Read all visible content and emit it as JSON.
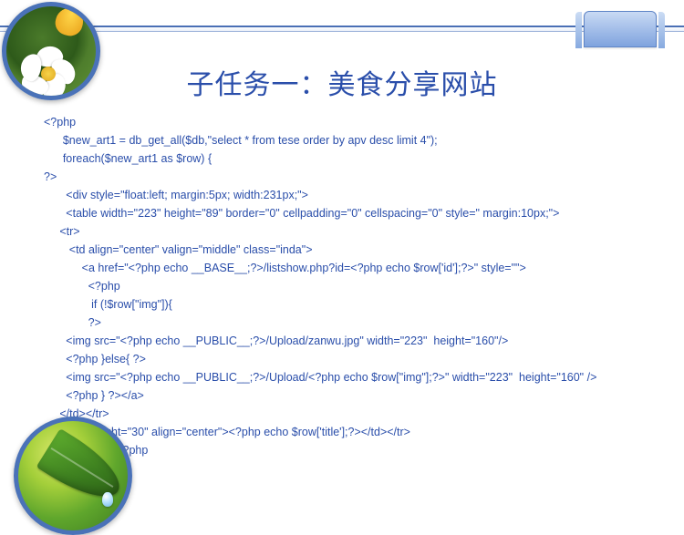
{
  "title": "子任务一：美食分享网站",
  "code_lines": [
    "<?php",
    "      $new_art1 = db_get_all($db,\"select * from tese order by apv desc limit 4\");",
    "      foreach($new_art1 as $row) {",
    "?>",
    "       <div style=\"float:left; margin:5px; width:231px;\">",
    "       <table width=\"223\" height=\"89\" border=\"0\" cellpadding=\"0\" cellspacing=\"0\" style=\" margin:10px;\">",
    "     <tr>",
    "        <td align=\"center\" valign=\"middle\" class=\"inda\">",
    "            <a href=\"<?php echo __BASE__;?>/listshow.php?id=<?php echo $row['id'];?>\" style=\"\">",
    "              <?php",
    "               if (!$row[\"img\"]){",
    "              ?>",
    "       <img src=\"<?php echo __PUBLIC__;?>/Upload/zanwu.jpg\" width=\"223\"  height=\"160\"/>",
    "       <?php }else{ ?>",
    "       <img src=\"<?php echo __PUBLIC__;?>/Upload/<?php echo $row[\"img\"];?>\" width=\"223\"  height=\"160\" />",
    "       <?php } ?></a>",
    "     </td></tr>",
    "  <tr><td height=\"30\" align=\"center\"><?php echo $row['title'];?></td></tr>",
    "</table></div><?php",
    "             }",
    "?>"
  ]
}
